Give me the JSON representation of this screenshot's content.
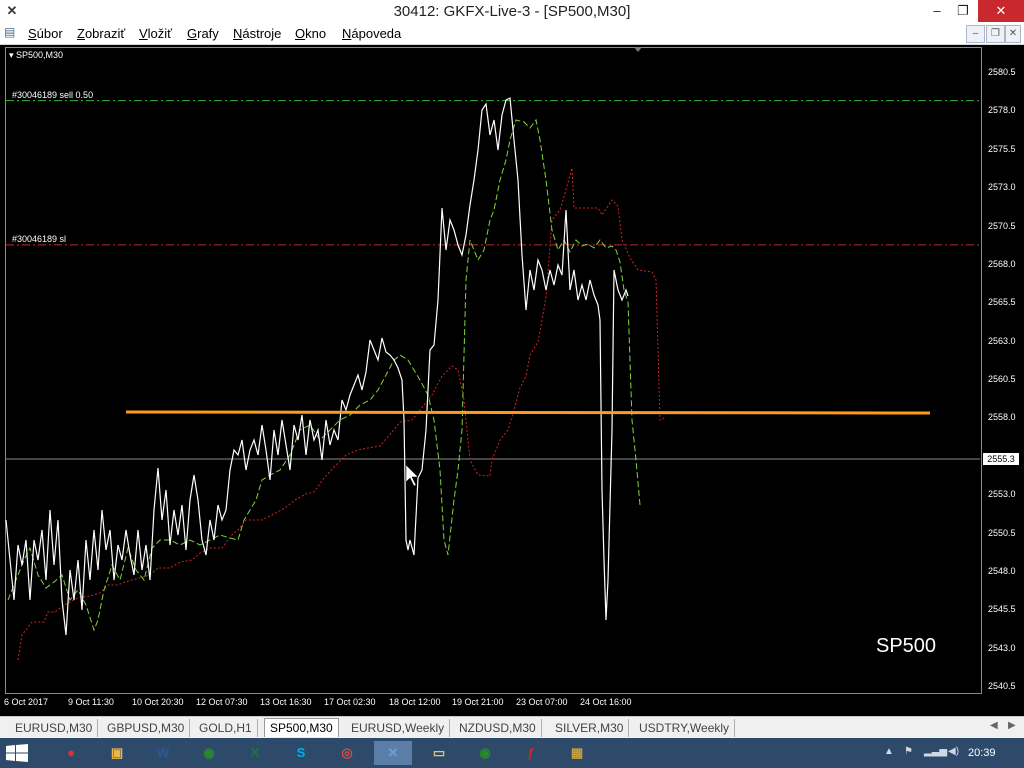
{
  "window": {
    "title": "30412: GKFX-Live-3 - [SP500,M30]",
    "minimize_glyph": "–",
    "maximize_glyph": "❐",
    "close_glyph": "✕"
  },
  "menu": [
    {
      "underline": "S",
      "rest": "úbor"
    },
    {
      "underline": "Z",
      "rest": "obraziť"
    },
    {
      "underline": "V",
      "rest": "ložiť"
    },
    {
      "underline": "G",
      "rest": "rafy"
    },
    {
      "underline": "N",
      "rest": "ástroje"
    },
    {
      "underline": "O",
      "rest": "kno"
    },
    {
      "underline": "N",
      "rest": "ápoveda"
    }
  ],
  "chart": {
    "symbol_label": "SP500,M30",
    "watermark": "SP500",
    "current_price": "2555.3",
    "price_axis": [
      "2580.5",
      "2578.0",
      "2575.5",
      "2573.0",
      "2570.5",
      "2568.0",
      "2565.5",
      "2563.0",
      "2560.5",
      "2558.0",
      "2553.0",
      "2550.5",
      "2548.0",
      "2545.5",
      "2543.0",
      "2540.5"
    ],
    "time_axis": [
      "6 Oct 2017",
      "9 Oct 11:30",
      "10 Oct 20:30",
      "12 Oct 07:30",
      "13 Oct 16:30",
      "17 Oct 02:30",
      "18 Oct 12:00",
      "19 Oct 21:00",
      "23 Oct 07:00",
      "24 Oct 16:00"
    ],
    "orders": [
      {
        "label": "#30046189 sell 0.50",
        "price": 2578.7,
        "color": "#2db82d"
      },
      {
        "label": "#30046189 sl",
        "price": 2569.3,
        "color": "#c0282d"
      }
    ],
    "colors": {
      "price_line": "#ffffff",
      "green_series": "#7fd63a",
      "red_series": "#d02525",
      "trend_line": "#ff9a1a"
    }
  },
  "tabs": [
    "EURUSD,M30",
    "GBPUSD,M30",
    "GOLD,H1",
    "SP500,M30",
    "EURUSD,Weekly",
    "NZDUSD,M30",
    "SILVER,M30",
    "USDTRY,Weekly"
  ],
  "active_tab": "SP500,M30",
  "taskbar": {
    "icons": [
      "windows-start",
      "paint",
      "explorer",
      "word",
      "metatrader",
      "excel",
      "skype",
      "chrome",
      "xcode-app",
      "folder",
      "metatrader-2",
      "flash",
      "image-viewer"
    ],
    "clock": "20:39"
  }
}
